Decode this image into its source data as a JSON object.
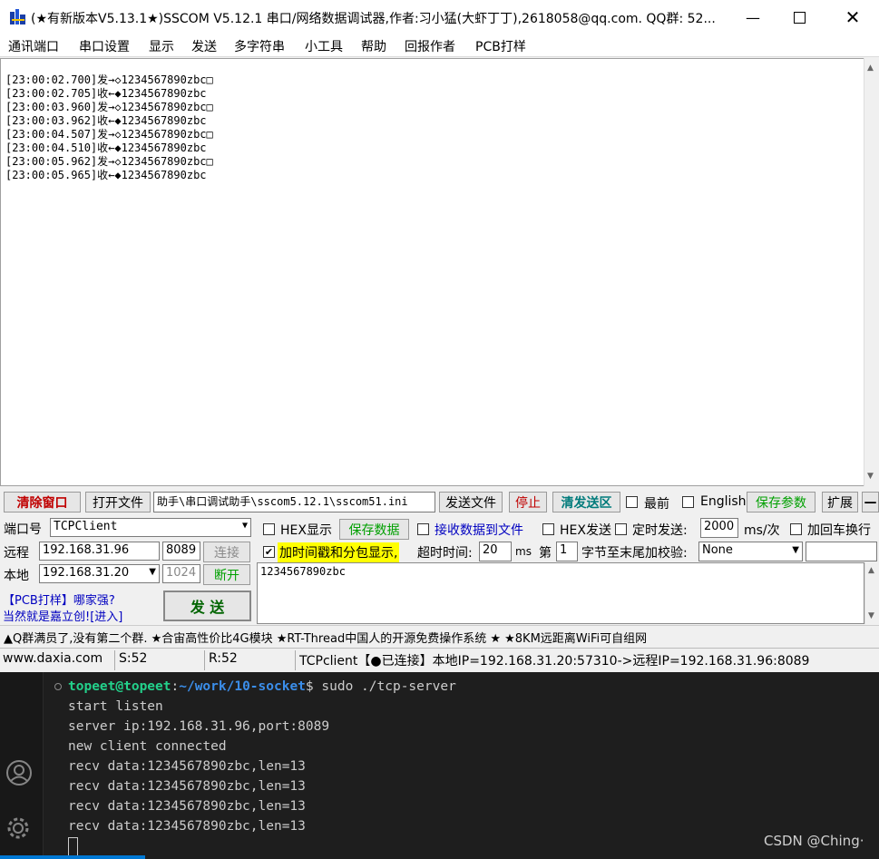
{
  "window": {
    "title": "(★有新版本V5.13.1★)SSCOM V5.12.1 串口/网络数据调试器,作者:习小猛(大虾丁丁),2618058@qq.com. QQ群: 52...",
    "icon": "sscom-app-icon",
    "controls": [
      "minimize-icon",
      "maximize-icon",
      "close-icon"
    ]
  },
  "menu": [
    "通讯端口",
    "串口设置",
    "显示",
    "发送",
    "多字符串",
    "小工具",
    "帮助",
    "回报作者",
    "PCB打样"
  ],
  "log_lines": [
    "[23:00:02.700]发→◇1234567890zbc□",
    "[23:00:02.705]收←◆1234567890zbc",
    "[23:00:03.960]发→◇1234567890zbc□",
    "[23:00:03.962]收←◆1234567890zbc",
    "[23:00:04.507]发→◇1234567890zbc□",
    "[23:00:04.510]收←◆1234567890zbc",
    "[23:00:05.962]发→◇1234567890zbc□",
    "[23:00:05.965]收←◆1234567890zbc"
  ],
  "toolbar": {
    "clear_window": "清除窗口",
    "open_file": "打开文件",
    "file_path": "助手\\串口调试助手\\sscom5.12.1\\sscom51.ini",
    "send_file": "发送文件",
    "stop": "停止",
    "clear_send": "清发送区",
    "topmost": "最前",
    "english": "English",
    "save_params": "保存参数",
    "expand": "扩展",
    "collapse": "—"
  },
  "port": {
    "port_label": "端口号",
    "port_value": "TCPClient",
    "remote_label": "远程",
    "remote_ip": "192.168.31.96",
    "remote_port": "8089",
    "connect": "连接",
    "local_label": "本地",
    "local_ip": "192.168.31.20",
    "local_port": "1024",
    "disconnect": "断开",
    "promo_line1": "【PCB打样】哪家强?",
    "promo_line2": "当然就是嘉立创![进入]",
    "send": "发  送"
  },
  "options": {
    "hex_display": "HEX显示",
    "save_data": "保存数据",
    "recv_to_file": "接收数据到文件",
    "hex_send": "HEX发送",
    "timed_send": "定时发送:",
    "interval": "2000",
    "interval_unit": "ms/次",
    "append_newline": "加回车换行",
    "timestamp": "加时间戳和分包显示,",
    "timeout_label": "超时时间:",
    "timeout_value": "20",
    "timeout_unit": "ms",
    "nth_label": "第",
    "nth_value": "1",
    "checksum_label": "字节至末尾加校验:",
    "checksum_value": "None"
  },
  "send_text": "1234567890zbc",
  "ticker": "▲Q群满员了,没有第二个群. ★合宙高性价比4G模块 ★RT-Thread中国人的开源免费操作系统 ★ ★8KM远距离WiFi可自组网",
  "status": {
    "site": "www.daxia.com",
    "sent": "S:52",
    "recv": "R:52",
    "conn": "TCPclient【●已连接】本地IP=192.168.31.20:57310->远程IP=192.168.31.96:8089"
  },
  "terminal": {
    "user": "topeet@topeet",
    "path": "~/work/10-socket",
    "command": "sudo ./tcp-server",
    "output": [
      "start listen",
      "server ip:192.168.31.96,port:8089",
      "new client connected",
      "recv data:1234567890zbc,len=13",
      "recv data:1234567890zbc,len=13",
      "recv data:1234567890zbc,len=13",
      "recv data:1234567890zbc,len=13"
    ],
    "side_icons": [
      "account-icon",
      "settings-gear-icon"
    ]
  },
  "watermark": "CSDN @Ching·",
  "colors": {
    "accent_red": "#c00000",
    "accent_green": "#00a000",
    "term_bg": "#1e1e1e",
    "term_user": "#23d18b",
    "term_path": "#3b8eea"
  }
}
